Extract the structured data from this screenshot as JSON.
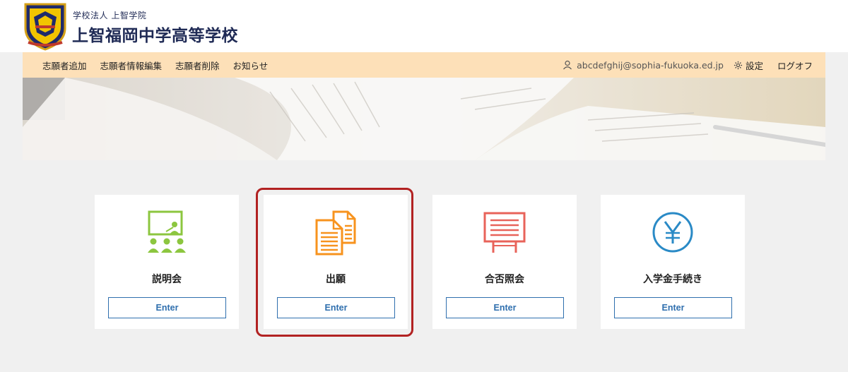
{
  "header": {
    "school_sub": "学校法人 上智学院",
    "school_name": "上智福岡中学高等学校"
  },
  "nav": {
    "items": [
      "志願者追加",
      "志願者情報編集",
      "志願者削除",
      "お知らせ"
    ],
    "email": "abcdefghij@sophia-fukuoka.ed.jp",
    "settings": "設定",
    "logout": "ログオフ"
  },
  "cards": [
    {
      "title": "説明会",
      "button": "Enter",
      "icon": "presentation-icon",
      "color": "#8cc63f"
    },
    {
      "title": "出願",
      "button": "Enter",
      "icon": "documents-icon",
      "color": "#f7931e"
    },
    {
      "title": "合否照会",
      "button": "Enter",
      "icon": "signboard-icon",
      "color": "#e8635a"
    },
    {
      "title": "入学金手続き",
      "button": "Enter",
      "icon": "yen-icon",
      "color": "#2a8ac6"
    }
  ],
  "colors": {
    "nav_bg": "#fde0b8",
    "accent_blue": "#2f6fae",
    "highlight_red": "#b22222"
  }
}
